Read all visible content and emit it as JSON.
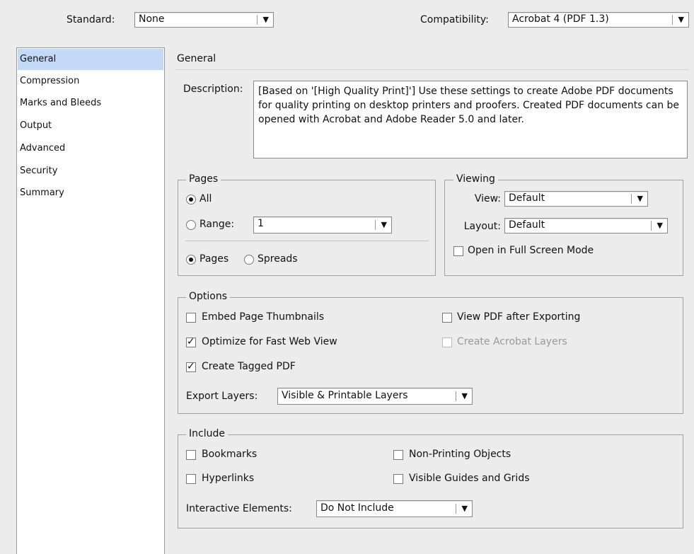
{
  "header": {
    "standard_label": "Standard:",
    "standard_value": "None",
    "compat_label": "Compatibility:",
    "compat_value": "Acrobat 4 (PDF 1.3)"
  },
  "sidebar": {
    "items": [
      {
        "label": "General"
      },
      {
        "label": "Compression"
      },
      {
        "label": "Marks and Bleeds"
      },
      {
        "label": "Output"
      },
      {
        "label": "Advanced"
      },
      {
        "label": "Security"
      },
      {
        "label": "Summary"
      }
    ],
    "selected": "General"
  },
  "panel": {
    "title": "General",
    "description_label": "Description:",
    "description_text": "[Based on '[High Quality Print]'] Use these settings to create Adobe PDF documents for quality printing on desktop printers and proofers. Created PDF documents can be opened with Acrobat and Adobe Reader 5.0 and later."
  },
  "pages": {
    "legend": "Pages",
    "all_label": "All",
    "range_label": "Range:",
    "range_value": "1",
    "pages_label": "Pages",
    "spreads_label": "Spreads",
    "all_selected": true,
    "pages_selected": true
  },
  "viewing": {
    "legend": "Viewing",
    "view_label": "View:",
    "view_value": "Default",
    "layout_label": "Layout:",
    "layout_value": "Default",
    "fullscreen_label": "Open in Full Screen Mode",
    "fullscreen_checked": false
  },
  "options": {
    "legend": "Options",
    "embed_thumbnails": {
      "label": "Embed Page Thumbnails",
      "checked": false
    },
    "optimize_web": {
      "label": "Optimize for Fast Web View",
      "checked": true
    },
    "tagged_pdf": {
      "label": "Create Tagged PDF",
      "checked": true
    },
    "view_after_export": {
      "label": "View PDF after Exporting",
      "checked": false
    },
    "acrobat_layers": {
      "label": "Create Acrobat Layers",
      "checked": false,
      "disabled": true
    },
    "export_layers_label": "Export Layers:",
    "export_layers_value": "Visible & Printable Layers"
  },
  "include": {
    "legend": "Include",
    "bookmarks": {
      "label": "Bookmarks",
      "checked": false
    },
    "hyperlinks": {
      "label": "Hyperlinks",
      "checked": false
    },
    "non_printing": {
      "label": "Non-Printing Objects",
      "checked": false
    },
    "guides_grids": {
      "label": "Visible Guides and Grids",
      "checked": false
    },
    "interactive_label": "Interactive Elements:",
    "interactive_value": "Do Not Include"
  },
  "glyphs": {
    "check": "✓",
    "dropdown_arrow": "▼"
  }
}
